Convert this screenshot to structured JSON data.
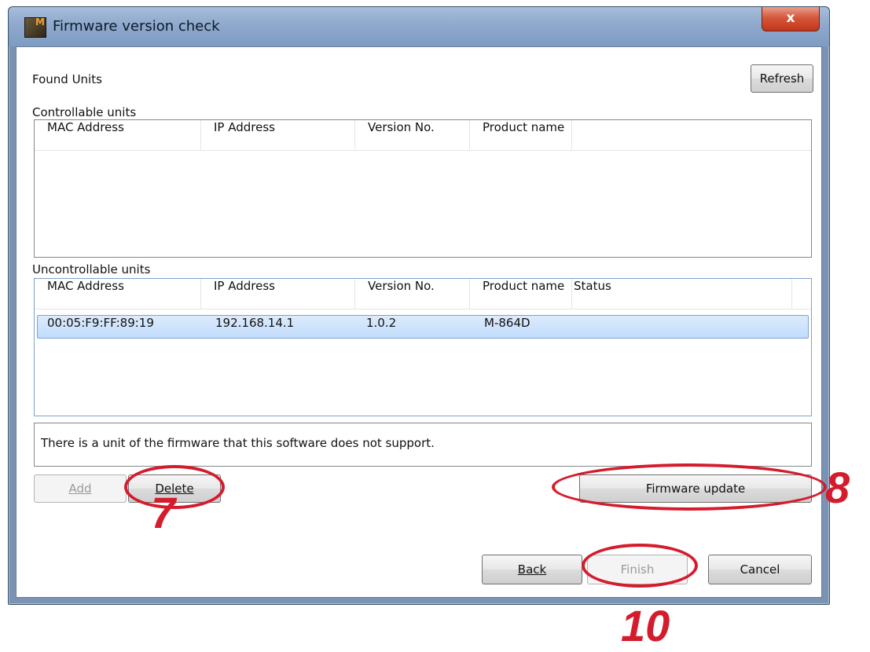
{
  "window": {
    "title": "Firmware version check",
    "close_glyph": "x",
    "app_icon_glyph": "M"
  },
  "found_units_label": "Found Units",
  "refresh_label": "Refresh",
  "controllable": {
    "label": "Controllable units",
    "columns": [
      "MAC Address",
      "IP Address",
      "Version No.",
      "Product name"
    ]
  },
  "uncontrollable": {
    "label": "Uncontrollable units",
    "columns": [
      "MAC Address",
      "IP Address",
      "Version No.",
      "Product name",
      "Status"
    ],
    "rows": [
      {
        "mac": "00:05:F9:FF:89:19",
        "ip": "192.168.14.1",
        "version": "1.0.2",
        "product": "M-864D",
        "status": ""
      }
    ]
  },
  "message": "There is a unit of the firmware that this software does not support.",
  "buttons": {
    "add": "Add",
    "delete": "Delete",
    "firmware_update": "Firmware update",
    "back": "Back",
    "finish": "Finish",
    "cancel": "Cancel"
  },
  "annotations": {
    "delete": "7",
    "firmware_update": "8",
    "finish": "10"
  },
  "colors": {
    "annotation_red": "#d41c2c",
    "selection_blue": "#c1dcfc",
    "titlebar": "#8ea9cc"
  }
}
